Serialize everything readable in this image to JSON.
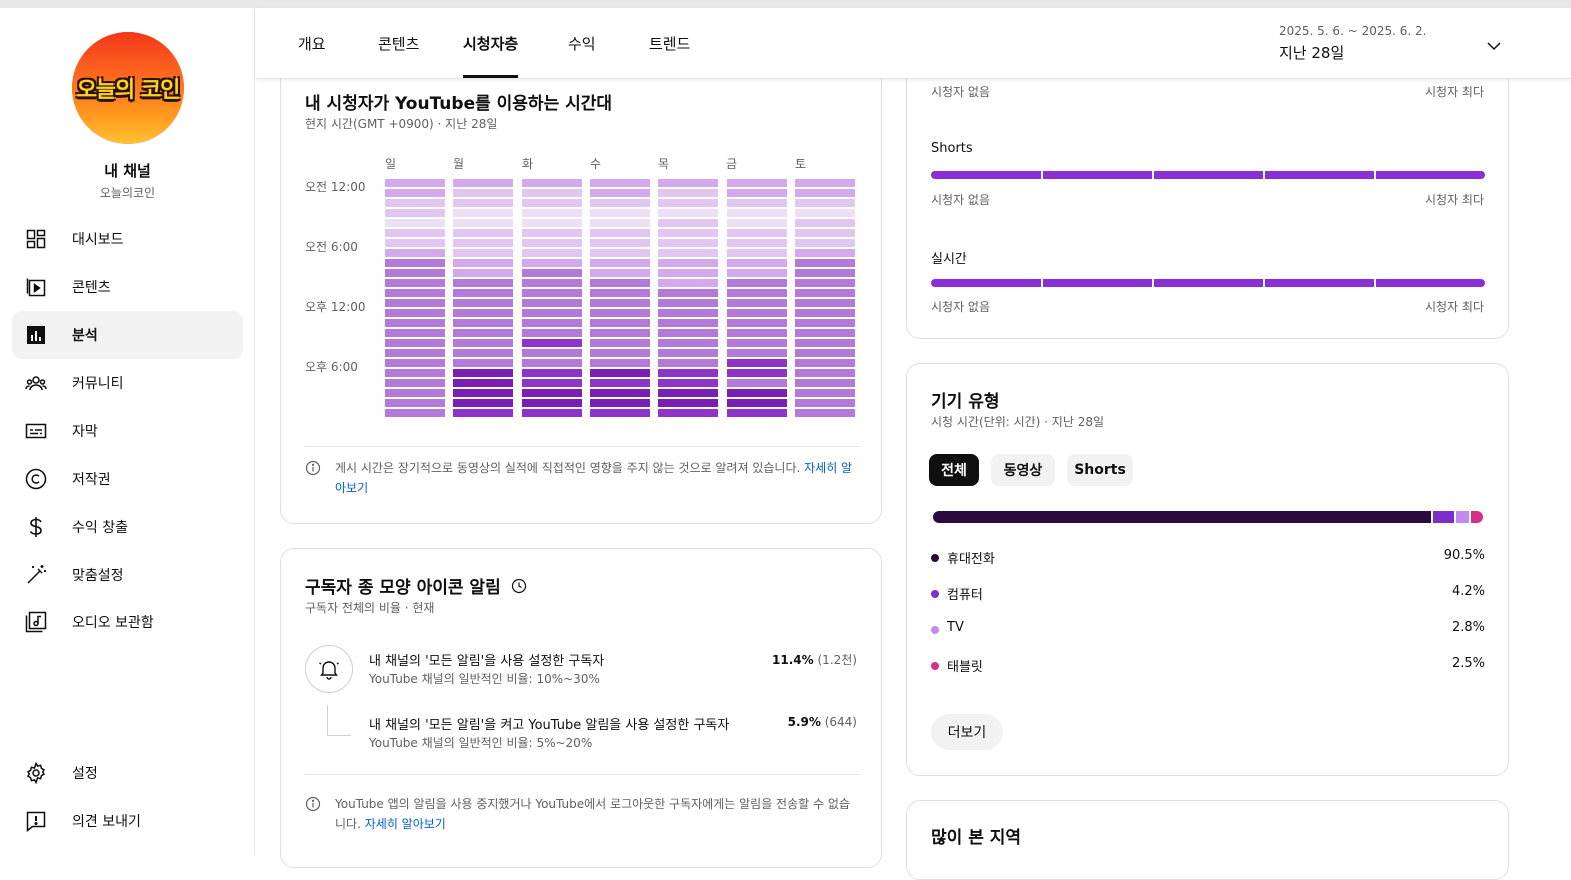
{
  "sidebar": {
    "avatar_text": "오늘의 코인",
    "channel_title": "내 채널",
    "channel_name": "오늘의코인",
    "items": [
      {
        "label": "대시보드",
        "icon": "dashboard-icon"
      },
      {
        "label": "콘텐츠",
        "icon": "content-icon"
      },
      {
        "label": "분석",
        "icon": "analytics-icon",
        "active": true
      },
      {
        "label": "커뮤니티",
        "icon": "community-icon"
      },
      {
        "label": "자막",
        "icon": "subtitles-icon"
      },
      {
        "label": "저작권",
        "icon": "copyright-icon"
      },
      {
        "label": "수익 창출",
        "icon": "monetization-icon"
      },
      {
        "label": "맞춤설정",
        "icon": "customization-icon"
      },
      {
        "label": "오디오 보관함",
        "icon": "audio-library-icon"
      }
    ],
    "bottom_items": [
      {
        "label": "설정",
        "icon": "settings-icon"
      },
      {
        "label": "의견 보내기",
        "icon": "feedback-icon"
      }
    ]
  },
  "header": {
    "tabs": [
      "개요",
      "콘텐츠",
      "시청자층",
      "수익",
      "트렌드"
    ],
    "active_tab": "시청자층",
    "date_range": "2025. 5. 6. ~ 2025. 6. 2.",
    "date_label": "지난 28일"
  },
  "watch_time_card": {
    "title": "내 시청자가 YouTube를 이용하는 시간대",
    "subtitle": "현지 시간(GMT +0900) · 지난 28일",
    "days": [
      "일",
      "월",
      "화",
      "수",
      "목",
      "금",
      "토"
    ],
    "time_labels": [
      "오전 12:00",
      "오전 6:00",
      "오후 12:00",
      "오후 6:00"
    ],
    "heatmap_levels": [
      [
        2,
        2,
        2,
        2,
        2,
        2,
        2
      ],
      [
        2,
        1,
        1,
        2,
        1,
        2,
        2
      ],
      [
        1,
        1,
        1,
        1,
        1,
        1,
        1
      ],
      [
        1,
        0,
        0,
        0,
        0,
        0,
        0
      ],
      [
        0,
        0,
        0,
        0,
        1,
        0,
        1
      ],
      [
        1,
        1,
        1,
        1,
        1,
        1,
        1
      ],
      [
        1,
        1,
        1,
        1,
        1,
        1,
        1
      ],
      [
        2,
        1,
        1,
        1,
        1,
        1,
        2
      ],
      [
        3,
        2,
        2,
        2,
        2,
        2,
        3
      ],
      [
        3,
        2,
        3,
        2,
        2,
        2,
        3
      ],
      [
        3,
        3,
        3,
        3,
        2,
        3,
        3
      ],
      [
        3,
        3,
        3,
        3,
        3,
        3,
        3
      ],
      [
        3,
        3,
        3,
        3,
        3,
        3,
        3
      ],
      [
        3,
        3,
        3,
        3,
        3,
        3,
        3
      ],
      [
        3,
        3,
        3,
        3,
        3,
        3,
        3
      ],
      [
        3,
        3,
        3,
        3,
        3,
        3,
        3
      ],
      [
        3,
        3,
        4,
        3,
        3,
        3,
        3
      ],
      [
        3,
        3,
        3,
        3,
        3,
        3,
        3
      ],
      [
        3,
        3,
        3,
        3,
        3,
        4,
        3
      ],
      [
        3,
        5,
        4,
        5,
        4,
        4,
        3
      ],
      [
        3,
        5,
        4,
        4,
        4,
        3,
        3
      ],
      [
        3,
        5,
        5,
        5,
        5,
        5,
        3
      ],
      [
        3,
        5,
        5,
        5,
        5,
        5,
        3
      ],
      [
        3,
        4,
        4,
        4,
        4,
        4,
        3
      ]
    ],
    "note": "게시 시간은 장기적으로 동영상의 실적에 직접적인 영향을 주지 않는 것으로 알려져 있습니다.",
    "note_link": "자세히 알아보기"
  },
  "bell_card": {
    "title": "구독자 종 모양 아이콘 알림",
    "subtitle": "구독자 전체의 비율 · 현재",
    "rows": [
      {
        "title": "내 채널의 '모든 알림'을 사용 설정한 구독자",
        "sub": "YouTube 채널의 일반적인 비율: 10%~30%",
        "pct": "11.4%",
        "count": "(1.2천)"
      },
      {
        "title": "내 채널의 '모든 알림'을 켜고 YouTube 알림을 사용 설정한 구독자",
        "sub": "YouTube 채널의 일반적인 비율: 5%~20%",
        "pct": "5.9%",
        "count": "(644)"
      }
    ],
    "note": "YouTube 앱의 알림을 사용 중지했거나 YouTube에서 로그아웃한 구독자에게는 알림을 전송할 수 없습니다.",
    "note_link": "자세히 알아보기"
  },
  "format_card": {
    "top_left": "시청자 없음",
    "top_right": "시청자 최다",
    "segments": [
      {
        "label": "Shorts",
        "left": "시청자 없음",
        "right": "시청자 최다"
      },
      {
        "label": "실시간",
        "left": "시청자 없음",
        "right": "시청자 최다"
      }
    ]
  },
  "device_card": {
    "title": "기기 유형",
    "subtitle": "시청 시간(단위: 시간) · 지난 28일",
    "chips": [
      "전체",
      "동영상",
      "Shorts"
    ],
    "active_chip": "전체",
    "devices": [
      {
        "name": "휴대전화",
        "pct": "90.5%",
        "value": 90.5,
        "color": "#2a0a3f"
      },
      {
        "name": "컴퓨터",
        "pct": "4.2%",
        "value": 4.2,
        "color": "#7d2fc9"
      },
      {
        "name": "TV",
        "pct": "2.8%",
        "value": 2.8,
        "color": "#c08af0"
      },
      {
        "name": "태블릿",
        "pct": "2.5%",
        "value": 2.5,
        "color": "#d82f86"
      }
    ],
    "more_label": "더보기"
  },
  "region_card": {
    "title": "많이 본 지역"
  },
  "colors": {
    "heat_levels": [
      "#eddff6",
      "#e0c6f1",
      "#d3a8ec",
      "#b37ad9",
      "#8e35c9",
      "#7a1fb3"
    ],
    "segment_bar": "#8a2fd6",
    "link": "#065fd4"
  }
}
